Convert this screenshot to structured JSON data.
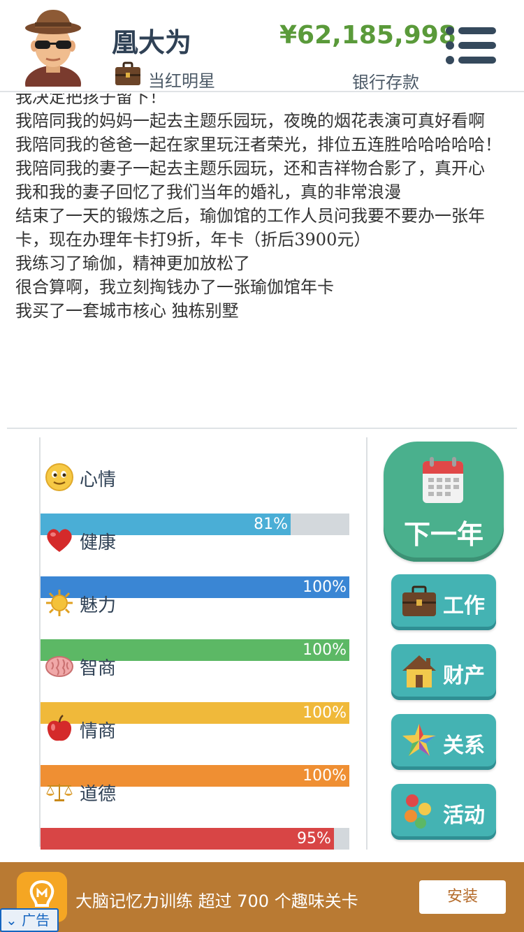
{
  "header": {
    "player_name": "凰大为",
    "job_title": "当红明星",
    "money": "¥62,185,998",
    "money_label": "银行存款"
  },
  "event_log": [
    "我决定把孩子留下！",
    "我陪同我的妈妈一起去主题乐园玩，夜晚的烟花表演可真好看啊",
    "我陪同我的爸爸一起在家里玩汪者荣光，排位五连胜哈哈哈哈哈！",
    "我陪同我的妻子一起去主题乐园玩，还和吉祥物合影了，真开心",
    "我和我的妻子回忆了我们当年的婚礼，真的非常浪漫",
    "结束了一天的锻炼之后，瑜伽馆的工作人员问我要不要办一张年卡，现在办理年卡打9折，年卡（折后3900元）",
    "我练习了瑜伽，精神更加放松了",
    "很合算啊，我立刻掏钱办了一张瑜伽馆年卡",
    "我买了一套城市核心 独栋别墅"
  ],
  "stats": [
    {
      "label": "心情",
      "value": 81,
      "display": "81%",
      "color": "#4aaed6",
      "icon": "smiley-icon"
    },
    {
      "label": "健康",
      "value": 100,
      "display": "100%",
      "color": "#3a86d4",
      "icon": "heart-icon"
    },
    {
      "label": "魅力",
      "value": 100,
      "display": "100%",
      "color": "#5cb865",
      "icon": "sun-icon"
    },
    {
      "label": "智商",
      "value": 100,
      "display": "100%",
      "color": "#f0b93a",
      "icon": "brain-icon"
    },
    {
      "label": "情商",
      "value": 100,
      "display": "100%",
      "color": "#ef8f33",
      "icon": "apple-icon"
    },
    {
      "label": "道德",
      "value": 95,
      "display": "95%",
      "color": "#d84545",
      "icon": "scales-icon"
    }
  ],
  "actions": {
    "next_year": "下一年",
    "work": "工作",
    "property": "财产",
    "relations": "关系",
    "activities": "活动"
  },
  "ad": {
    "text": "大脑记忆力训练 超过 700 个趣味关卡",
    "install": "安装",
    "badge": "广告"
  }
}
